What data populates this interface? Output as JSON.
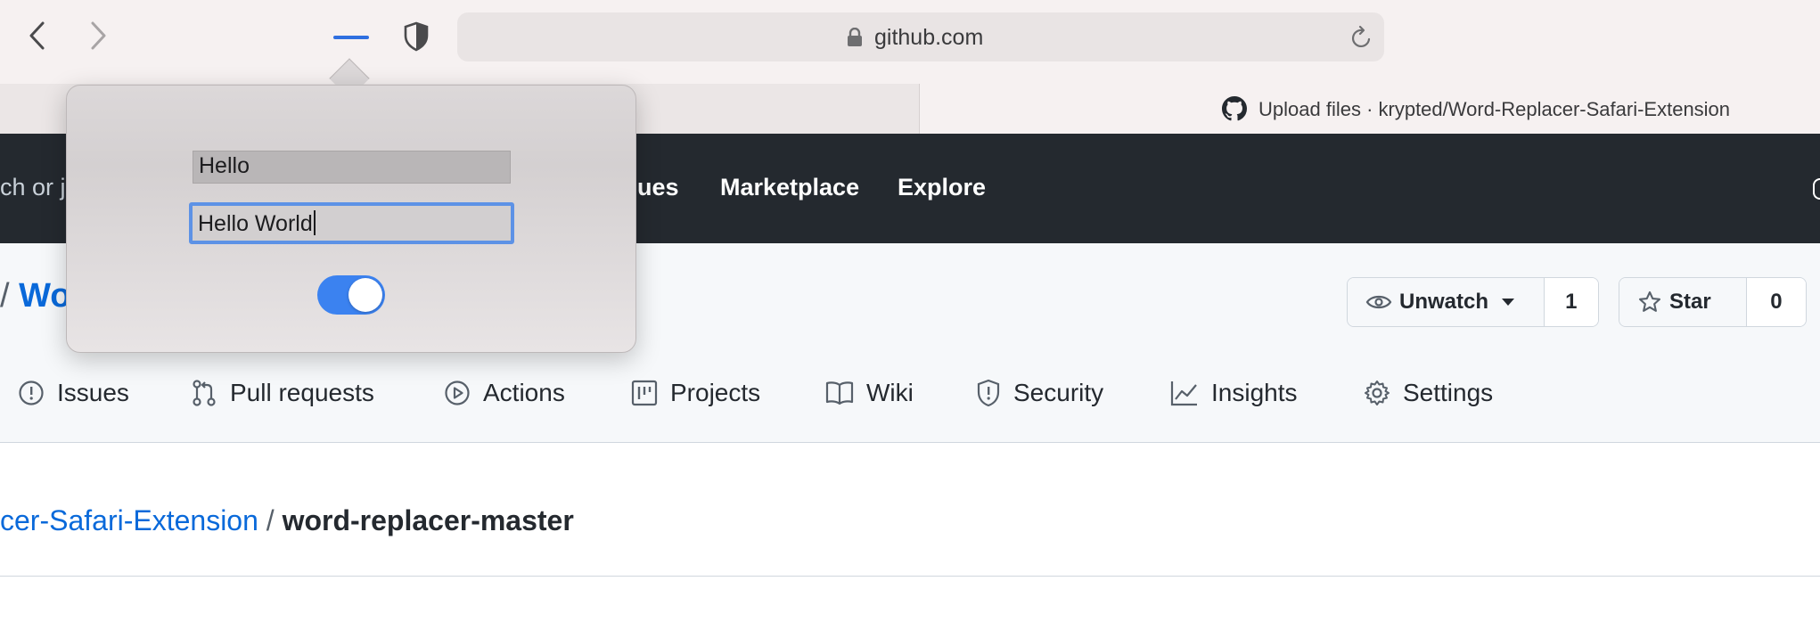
{
  "browser": {
    "address": "github.com",
    "tabs": [
      {
        "title": ""
      },
      {
        "title": "Upload files · krypted/Word-Replacer-Safari-Extension"
      }
    ]
  },
  "header": {
    "search_fragment": "ch or ju",
    "nav": [
      "sues",
      "Marketplace",
      "Explore"
    ]
  },
  "repo": {
    "sep": "/",
    "name_fragment": "Wo",
    "watch": {
      "label": "Unwatch",
      "count": "1"
    },
    "star": {
      "label": "Star",
      "count": "0"
    },
    "tabs": [
      "Issues",
      "Pull requests",
      "Actions",
      "Projects",
      "Wiki",
      "Security",
      "Insights",
      "Settings"
    ]
  },
  "content": {
    "breadcrumb": {
      "repo": "cer-Safari-Extension",
      "sep": " / ",
      "current": "word-replacer-master"
    }
  },
  "extension_popover": {
    "find_value": "Hello",
    "replace_value": "Hello World",
    "enabled": true
  },
  "colors": {
    "accent": "#2f6fe0",
    "link": "#0969da",
    "header_bg": "#24292f",
    "toggle_on": "#3b82f0"
  }
}
